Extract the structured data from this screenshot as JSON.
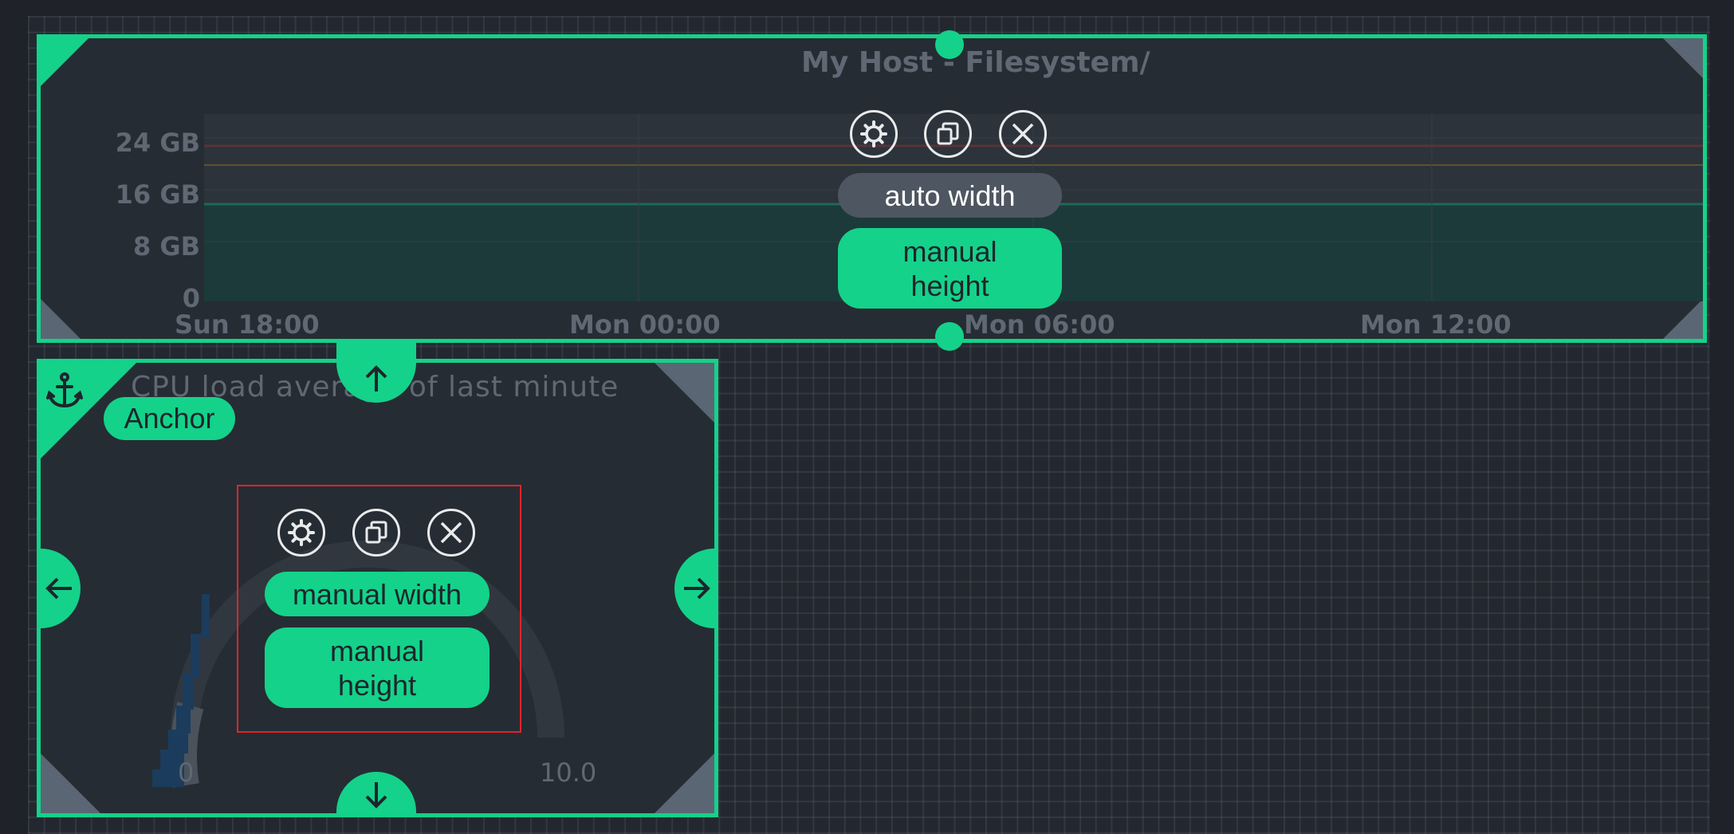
{
  "dashlet_filesystem": {
    "title": "My Host - Filesystem/",
    "y_ticks": [
      "24 GB",
      "16 GB",
      "8 GB",
      "0"
    ],
    "x_ticks": [
      "Sun 18:00",
      "Mon 00:00",
      "Mon 06:00",
      "Mon 12:00"
    ],
    "width_mode": "auto width",
    "height_mode": "manual\nheight"
  },
  "dashlet_cpu": {
    "title": "CPU load average of last minute",
    "anchor_label": "Anchor",
    "gauge_min": "0",
    "gauge_max": "10.0",
    "width_mode": "manual width",
    "height_mode": "manual\nheight"
  },
  "icons": [
    "settings-icon",
    "clone-icon",
    "close-icon",
    "anchor-icon",
    "arrow-up-icon",
    "arrow-down-icon",
    "arrow-left-icon",
    "arrow-right-icon"
  ],
  "colors": {
    "accent": "#14d28a",
    "background": "#1f2329",
    "grey_pill": "#4d5661",
    "highlight": "#e0242a"
  }
}
